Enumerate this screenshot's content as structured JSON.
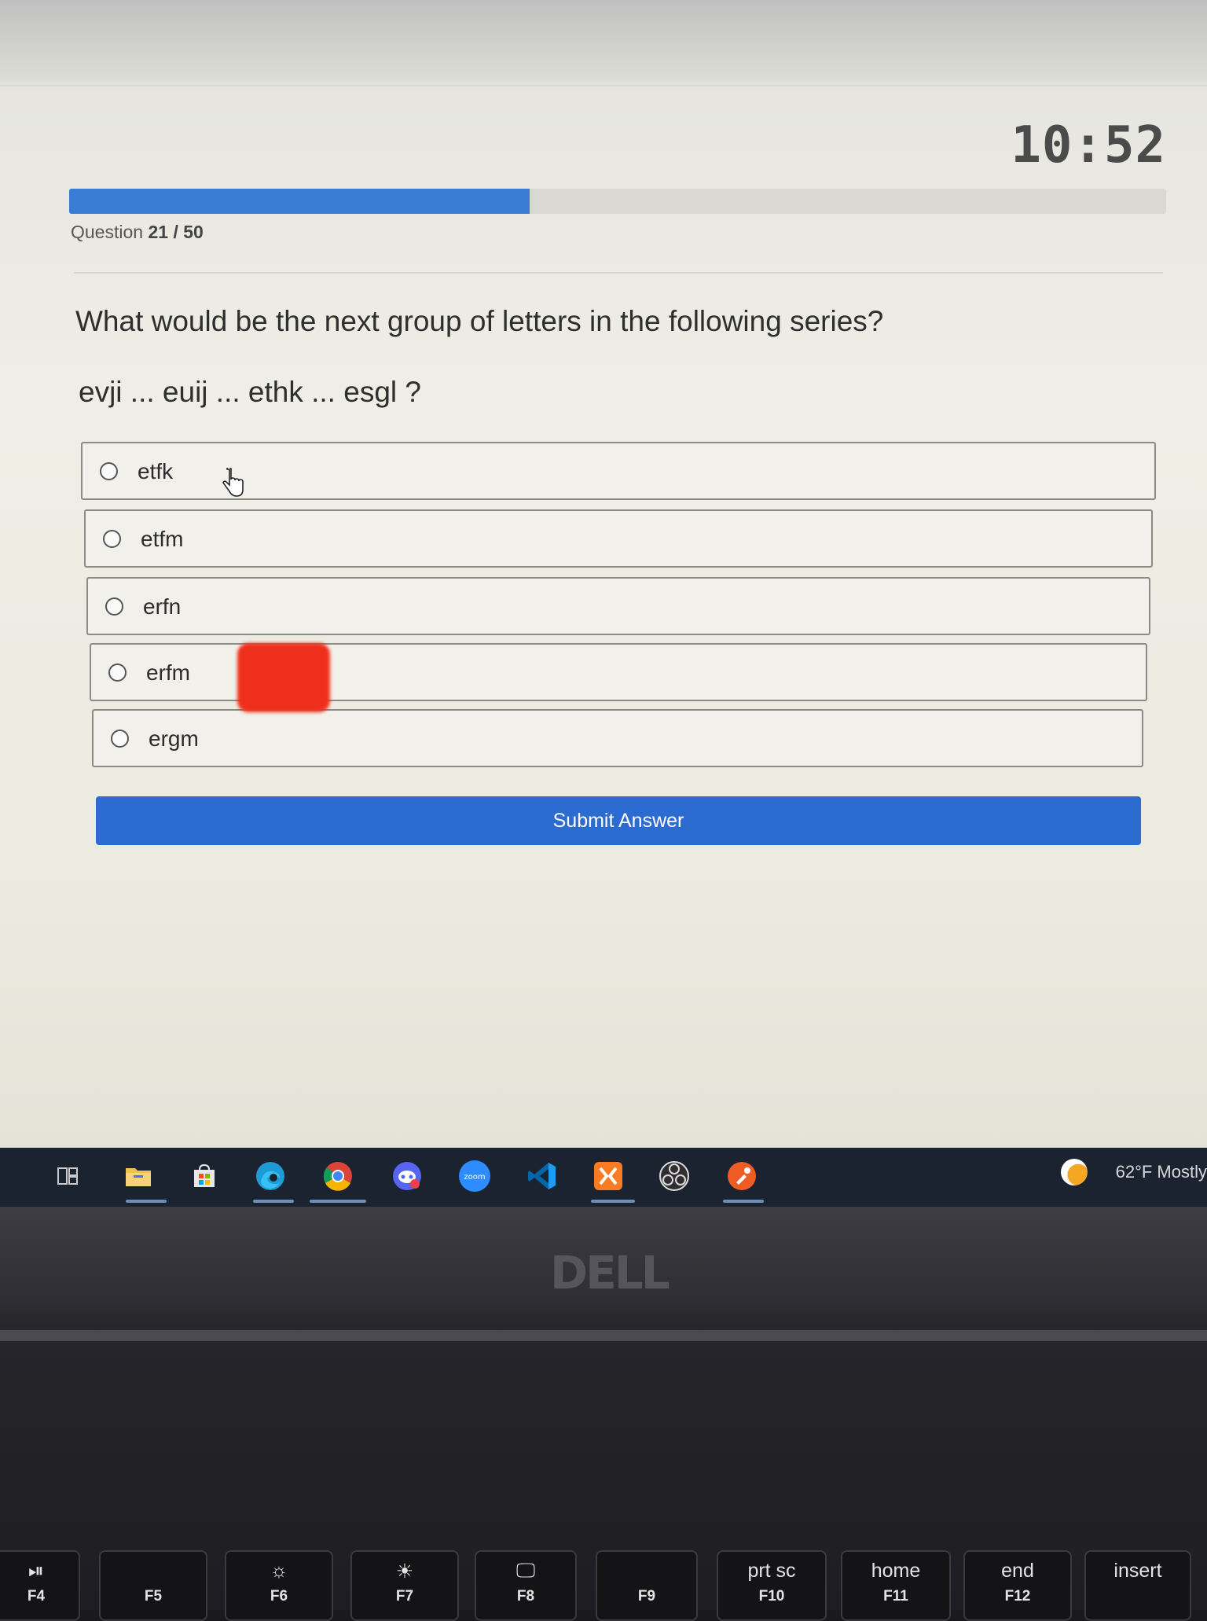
{
  "timer": "10:52",
  "progress": {
    "current": 21,
    "total": 50,
    "fraction": 0.42
  },
  "question": {
    "counter_label": "Question",
    "counter_current": "21",
    "counter_total": "/ 50",
    "text": "What would be the next group of letters in the following series?",
    "series": "evji ... euij ... ethk ... esgl ?"
  },
  "options": [
    {
      "label": "etfk"
    },
    {
      "label": "etfm"
    },
    {
      "label": "erfn"
    },
    {
      "label": "erfm"
    },
    {
      "label": "ergm"
    }
  ],
  "submit_label": "Submit Answer",
  "taskbar": {
    "apps": [
      "task-view",
      "file-explorer",
      "microsoft-store",
      "edge",
      "chrome",
      "discord",
      "zoom",
      "vscode",
      "xampp",
      "obs",
      "postman"
    ],
    "zoom_label": "zoom",
    "weather": "62°F Mostly"
  },
  "laptop": {
    "brand": "DELL"
  },
  "keys": [
    {
      "top": "⏯",
      "bottom": "F4"
    },
    {
      "top": "",
      "bottom": "F5"
    },
    {
      "top": "☼",
      "bottom": "F6"
    },
    {
      "top": "☀",
      "bottom": "F7"
    },
    {
      "top": "🖵",
      "bottom": "F8"
    },
    {
      "top": "",
      "bottom": "F9"
    },
    {
      "top": "prt sc",
      "bottom": "F10"
    },
    {
      "top": "home",
      "bottom": "F11"
    },
    {
      "top": "end",
      "bottom": "F12"
    },
    {
      "top": "insert",
      "bottom": ""
    }
  ],
  "colors": {
    "accent": "#2c6bd0",
    "progress": "#3a7bd5",
    "redaction": "#ef2f1c"
  }
}
